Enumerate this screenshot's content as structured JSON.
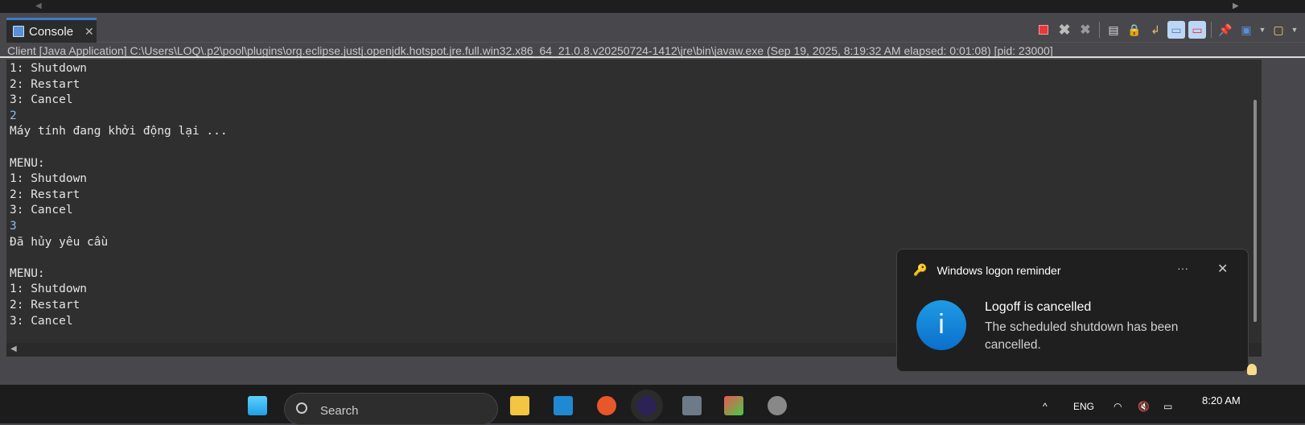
{
  "console_tab": {
    "label": "Console"
  },
  "toolbar": {
    "icons": [
      "terminate-icon",
      "remove-launch-icon",
      "remove-all-terminated-icon",
      "clear-console-icon",
      "scroll-lock-icon",
      "word-wrap-icon",
      "show-on-stdout-icon",
      "show-on-stderr-icon",
      "pin-console-icon",
      "display-selected-console-icon",
      "open-console-icon"
    ]
  },
  "process_info": "Client [Java Application] C:\\Users\\LOQ\\.p2\\pool\\plugins\\org.eclipse.justj.openjdk.hotspot.jre.full.win32.x86_64_21.0.8.v20250724-1412\\jre\\bin\\javaw.exe  (Sep 19, 2025, 8:19:32 AM elapsed: 0:01:08) [pid: 23000]",
  "console_lines": [
    {
      "text": "1: Shutdown",
      "input": false
    },
    {
      "text": "2: Restart",
      "input": false
    },
    {
      "text": "3: Cancel",
      "input": false
    },
    {
      "text": "2",
      "input": true
    },
    {
      "text": "Máy tính đang khởi động lại ...",
      "input": false
    },
    {
      "text": "",
      "input": false
    },
    {
      "text": "MENU:",
      "input": false
    },
    {
      "text": "1: Shutdown",
      "input": false
    },
    {
      "text": "2: Restart",
      "input": false
    },
    {
      "text": "3: Cancel",
      "input": false
    },
    {
      "text": "3",
      "input": true
    },
    {
      "text": "Đã hủy yêu cầu",
      "input": false
    },
    {
      "text": "",
      "input": false
    },
    {
      "text": "MENU:",
      "input": false
    },
    {
      "text": "1: Shutdown",
      "input": false
    },
    {
      "text": "2: Restart",
      "input": false
    },
    {
      "text": "3: Cancel",
      "input": false
    }
  ],
  "notification": {
    "app": "Windows logon reminder",
    "more": "···",
    "close": "✕",
    "title": "Logoff is cancelled",
    "body": "The scheduled shutdown has been cancelled.",
    "icon": "info-icon"
  },
  "taskbar": {
    "search_placeholder": "Search",
    "language": "ENG",
    "time": "8:20 AM"
  }
}
